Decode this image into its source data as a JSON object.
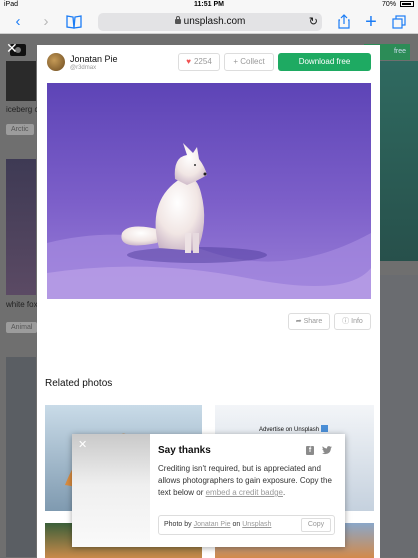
{
  "status_bar": {
    "device": "iPad",
    "time": "11:51 PM",
    "battery": "70%"
  },
  "toolbar": {
    "url": "unsplash.com"
  },
  "background": {
    "label_1": "iceberg c",
    "tag_1": "Arctic",
    "label_2": "white fox",
    "tag_2": "Animal",
    "right_button": "free"
  },
  "photo_header": {
    "author_name": "Jonatan Pie",
    "author_username": "@r3dmax",
    "like_count": "2254",
    "collect_label": "Collect",
    "download_label": "Download free"
  },
  "actions": {
    "share_label": "Share",
    "info_label": "Info"
  },
  "related": {
    "title": "Related photos",
    "advert_label": "Advertise on Unsplash"
  },
  "say_thanks": {
    "title": "Say thanks",
    "body_text": "Crediting isn't required, but is appreciated and allows photographers to gain exposure. Copy the text below or ",
    "embed_link": "embed a credit badge",
    "body_end": ".",
    "credit_prefix": "Photo by ",
    "credit_author": "Jonatan Pie",
    "credit_on": " on ",
    "credit_site": "Unsplash",
    "copy_label": "Copy"
  },
  "colors": {
    "accent": "#1b7cf5",
    "download": "#1eaa62",
    "heart": "#f15151"
  }
}
